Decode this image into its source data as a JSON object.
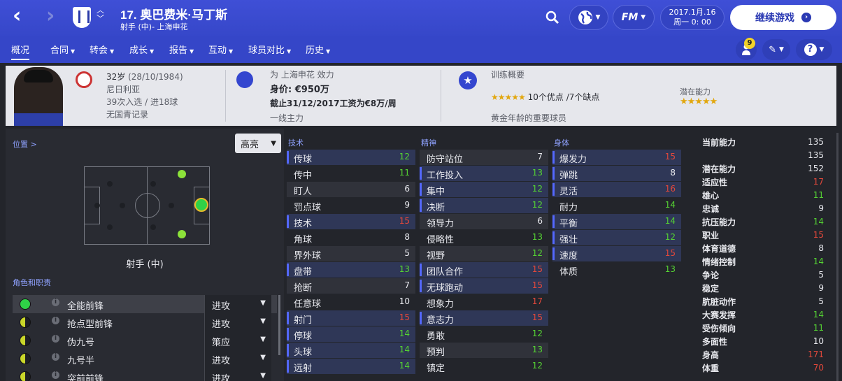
{
  "header": {
    "back_icon": "chevron-left-icon",
    "forward_icon": "chevron-right-icon",
    "player_name": "17. 奥巴费米·马丁斯",
    "player_subtitle": "射手 (中)- 上海申花",
    "date_line1": "2017.1月.16",
    "date_line2": "周一 0: 00",
    "continue_label": "继续游戏",
    "fm_label": "FM"
  },
  "tabs": [
    {
      "label": "概况"
    },
    {
      "label": "合同"
    },
    {
      "label": "转会"
    },
    {
      "label": "成长"
    },
    {
      "label": "报告"
    },
    {
      "label": "互动"
    },
    {
      "label": "球员对比"
    },
    {
      "label": "历史"
    }
  ],
  "notifications_count": "9",
  "info": {
    "age": "32岁",
    "dob": "(28/10/1984)",
    "nationality": "尼日利亚",
    "caps": "39次入选 / 进18球",
    "youth": "无国青记录",
    "club_line": "为 上海申花 效力",
    "value": "身价: €950万",
    "contract": "截止31/12/2017工资为€8万/周",
    "squad_status": "一线主力",
    "training_title": "训练概要",
    "training_stars": "★★★★★",
    "training_summary": "10个优点 /7个缺点",
    "training_note": "黄金年龄的重要球员",
    "potential_label": "潜在能力",
    "potential_stars": "★★★★★"
  },
  "left": {
    "position_link": "位置 >",
    "highlight_label": "高亮",
    "position_name": "射手 (中)",
    "roles_title": "角色和职责",
    "roles": [
      {
        "name": "全能前锋",
        "duty": "进攻",
        "color": "#2fd147"
      },
      {
        "name": "抢点型前锋",
        "duty": "进攻",
        "color": "#c9d62a"
      },
      {
        "name": "伪九号",
        "duty": "策应",
        "color": "#c9d62a"
      },
      {
        "name": "九号半",
        "duty": "进攻",
        "color": "#c9d62a"
      },
      {
        "name": "突前前锋",
        "duty": "进攻",
        "color": "#c9d62a"
      }
    ]
  },
  "attributes": {
    "technical_title": "技术",
    "mental_title": "精神",
    "physical_title": "身体",
    "technical": [
      {
        "name": "传球",
        "value": "12"
      },
      {
        "name": "传中",
        "value": "11"
      },
      {
        "name": "盯人",
        "value": "6"
      },
      {
        "name": "罚点球",
        "value": "9"
      },
      {
        "name": "技术",
        "value": "15"
      },
      {
        "name": "角球",
        "value": "8"
      },
      {
        "name": "界外球",
        "value": "5"
      },
      {
        "name": "盘带",
        "value": "13"
      },
      {
        "name": "抢断",
        "value": "7"
      },
      {
        "name": "任意球",
        "value": "10"
      },
      {
        "name": "射门",
        "value": "15"
      },
      {
        "name": "停球",
        "value": "14"
      },
      {
        "name": "头球",
        "value": "14"
      },
      {
        "name": "远射",
        "value": "14"
      }
    ],
    "mental": [
      {
        "name": "防守站位",
        "value": "7"
      },
      {
        "name": "工作投入",
        "value": "13"
      },
      {
        "name": "集中",
        "value": "12"
      },
      {
        "name": "决断",
        "value": "12"
      },
      {
        "name": "领导力",
        "value": "6"
      },
      {
        "name": "侵略性",
        "value": "13"
      },
      {
        "name": "视野",
        "value": "12"
      },
      {
        "name": "团队合作",
        "value": "15"
      },
      {
        "name": "无球跑动",
        "value": "15"
      },
      {
        "name": "想象力",
        "value": "17"
      },
      {
        "name": "意志力",
        "value": "15"
      },
      {
        "name": "勇敢",
        "value": "12"
      },
      {
        "name": "预判",
        "value": "13"
      },
      {
        "name": "镇定",
        "value": "12"
      }
    ],
    "physical": [
      {
        "name": "爆发力",
        "value": "15"
      },
      {
        "name": "弹跳",
        "value": "8"
      },
      {
        "name": "灵活",
        "value": "16"
      },
      {
        "name": "耐力",
        "value": "14"
      },
      {
        "name": "平衡",
        "value": "14"
      },
      {
        "name": "强壮",
        "value": "12"
      },
      {
        "name": "速度",
        "value": "15"
      },
      {
        "name": "体质",
        "value": "13"
      }
    ]
  },
  "stats": [
    {
      "name": "当前能力",
      "value": "135"
    },
    {
      "name": "",
      "value": "135"
    },
    {
      "name": "潜在能力",
      "value": "152"
    },
    {
      "name": "适应性",
      "value": "17"
    },
    {
      "name": "雄心",
      "value": "11"
    },
    {
      "name": "忠诚",
      "value": "9"
    },
    {
      "name": "抗压能力",
      "value": "14"
    },
    {
      "name": "职业",
      "value": "15"
    },
    {
      "name": "体育道德",
      "value": "8"
    },
    {
      "name": "情绪控制",
      "value": "14"
    },
    {
      "name": "争论",
      "value": "5"
    },
    {
      "name": "稳定",
      "value": "9"
    },
    {
      "name": "肮脏动作",
      "value": "5"
    },
    {
      "name": "大赛发挥",
      "value": "14"
    },
    {
      "name": "受伤倾向",
      "value": "11"
    },
    {
      "name": "多面性",
      "value": "10"
    },
    {
      "name": "身高",
      "value": "171"
    },
    {
      "name": "体重",
      "value": "70"
    }
  ],
  "colors": {
    "accent": "#3647c9",
    "good": "#55d233",
    "bad": "#e2483b",
    "panel": "#292b32"
  }
}
